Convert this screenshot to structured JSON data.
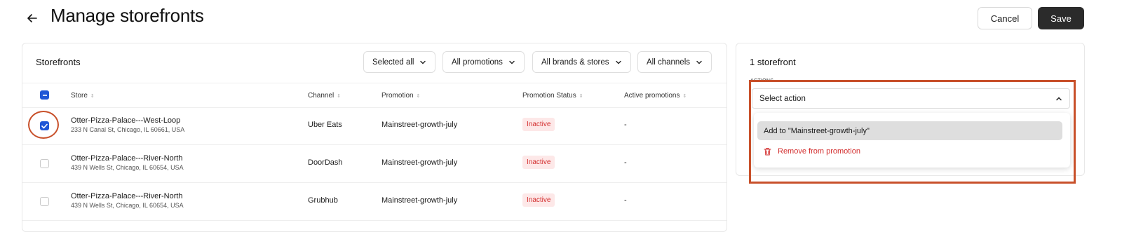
{
  "header": {
    "title": "Manage storefronts",
    "cancel_label": "Cancel",
    "save_label": "Save"
  },
  "storefronts": {
    "title": "Storefronts",
    "filters": [
      "Selected all",
      "All promotions",
      "All brands & stores",
      "All channels"
    ],
    "columns": [
      "Store",
      "Channel",
      "Promotion",
      "Promotion Status",
      "Active promotions"
    ],
    "rows": [
      {
        "name": "Otter-Pizza-Palace---West-Loop",
        "address": "233 N Canal St, Chicago, IL 60661, USA",
        "channel": "Uber Eats",
        "promotion": "Mainstreet-growth-july",
        "status": "Inactive",
        "active_promotions": "-",
        "checked": true
      },
      {
        "name": "Otter-Pizza-Palace---River-North",
        "address": "439 N Wells St, Chicago, IL 60654, USA",
        "channel": "DoorDash",
        "promotion": "Mainstreet-growth-july",
        "status": "Inactive",
        "active_promotions": "-",
        "checked": false
      },
      {
        "name": "Otter-Pizza-Palace---River-North",
        "address": "439 N Wells St, Chicago, IL 60654, USA",
        "channel": "Grubhub",
        "promotion": "Mainstreet-growth-july",
        "status": "Inactive",
        "active_promotions": "-",
        "checked": false
      }
    ]
  },
  "side_panel": {
    "title": "1 storefront",
    "actions_label": "ACTIONS",
    "select_placeholder": "Select action",
    "menu": [
      {
        "label": "Add to \"Mainstreet-growth-july\"",
        "icon": "none",
        "highlighted": true
      },
      {
        "label": "Remove from promotion",
        "icon": "trash-icon",
        "danger": true
      }
    ]
  },
  "icons": {
    "back": "arrow-left-icon",
    "dropdown": "chevron-down-icon",
    "select_open": "chevron-up-icon",
    "sort": "sort-icon",
    "remove": "trash-icon"
  },
  "colors": {
    "primary_button": "#2b2b2b",
    "checkbox_active": "#1f56d6",
    "danger": "#d32f2f",
    "badge_bg": "#fde8e8",
    "annotation": "#c8502a"
  }
}
